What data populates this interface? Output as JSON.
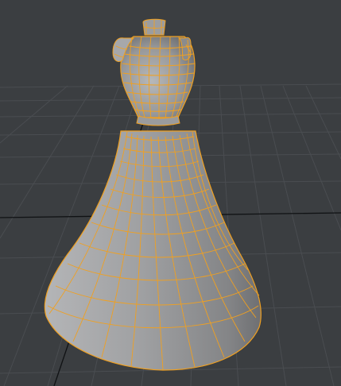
{
  "viewport": {
    "background_color": "#3b3e41",
    "grid_color": "#4a4d51",
    "grid_major_color": "#101214",
    "mesh_shade_color": "#8f9092",
    "wireframe_color": "#f0a020",
    "object_icon": "dress-form-mesh-icon"
  }
}
